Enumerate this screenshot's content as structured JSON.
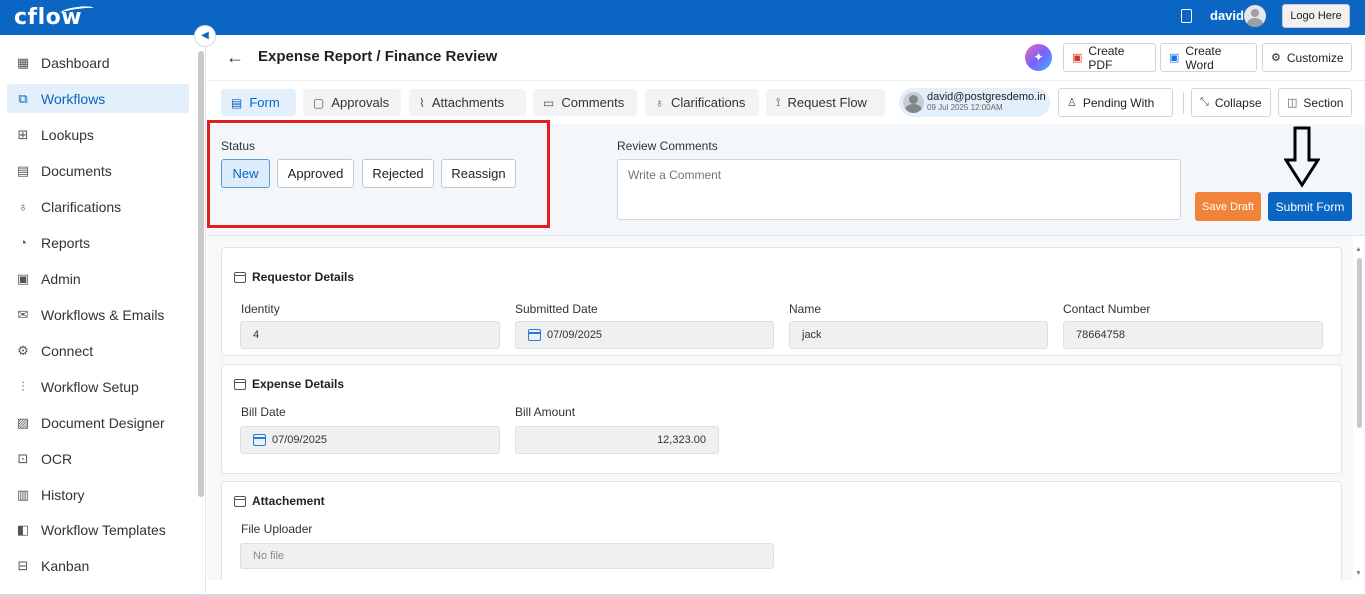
{
  "app": {
    "logo": "cflow",
    "user_name": "david",
    "logout_label": "Logo Here"
  },
  "sidebar": {
    "items": [
      {
        "label": "Dashboard",
        "icon": "dashboard-icon"
      },
      {
        "label": "Workflows",
        "icon": "workflows-icon",
        "active": true
      },
      {
        "label": "Lookups",
        "icon": "table-icon"
      },
      {
        "label": "Documents",
        "icon": "document-icon"
      },
      {
        "label": "Clarifications",
        "icon": "bulb-icon"
      },
      {
        "label": "Reports",
        "icon": "pie-chart-icon"
      },
      {
        "label": "Admin",
        "icon": "admin-icon"
      },
      {
        "label": "Workflows & Emails",
        "icon": "mail-icon"
      },
      {
        "label": "Connect",
        "icon": "connect-icon"
      },
      {
        "label": "Workflow Setup",
        "icon": "sliders-icon"
      },
      {
        "label": "Document Designer",
        "icon": "designer-icon"
      },
      {
        "label": "OCR",
        "icon": "scan-icon"
      },
      {
        "label": "History",
        "icon": "history-icon"
      },
      {
        "label": "Workflow Templates",
        "icon": "template-icon"
      },
      {
        "label": "Kanban",
        "icon": "kanban-icon"
      }
    ]
  },
  "header": {
    "title": "Expense Report / Finance Review",
    "create_pdf": "Create PDF",
    "create_word": "Create Word",
    "customize": "Customize"
  },
  "tabs": {
    "form": "Form",
    "approvals": "Approvals",
    "attachments": "Attachments",
    "comments": "Comments",
    "clarifications": "Clarifications",
    "request_flow": "Request Flow",
    "user_email": "david@postgresdemo.in",
    "user_date": "09 Jul 2025 12:00AM",
    "pending_with": "Pending With",
    "collapse": "Collapse",
    "section": "Section"
  },
  "status": {
    "label": "Status",
    "options": [
      "New",
      "Approved",
      "Rejected",
      "Reassign"
    ],
    "selected": "New",
    "review_label": "Review Comments",
    "review_placeholder": "Write a Comment",
    "save_draft": "Save Draft",
    "submit_form": "Submit Form"
  },
  "requestor": {
    "title": "Requestor Details",
    "identity_label": "Identity",
    "identity_value": "4",
    "submitted_date_label": "Submitted Date",
    "submitted_date_value": "07/09/2025",
    "name_label": "Name",
    "name_value": "jack",
    "contact_label": "Contact Number",
    "contact_value": "78664758"
  },
  "expense": {
    "title": "Expense Details",
    "bill_date_label": "Bill Date",
    "bill_date_value": "07/09/2025",
    "bill_amount_label": "Bill Amount",
    "bill_amount_value": "12,323.00"
  },
  "attachment": {
    "title": "Attachement",
    "uploader_label": "File Uploader",
    "uploader_value": "No file"
  },
  "colors": {
    "brand": "#0a66c2",
    "save_draft": "#f2833a",
    "highlight_box": "#e0201f"
  }
}
